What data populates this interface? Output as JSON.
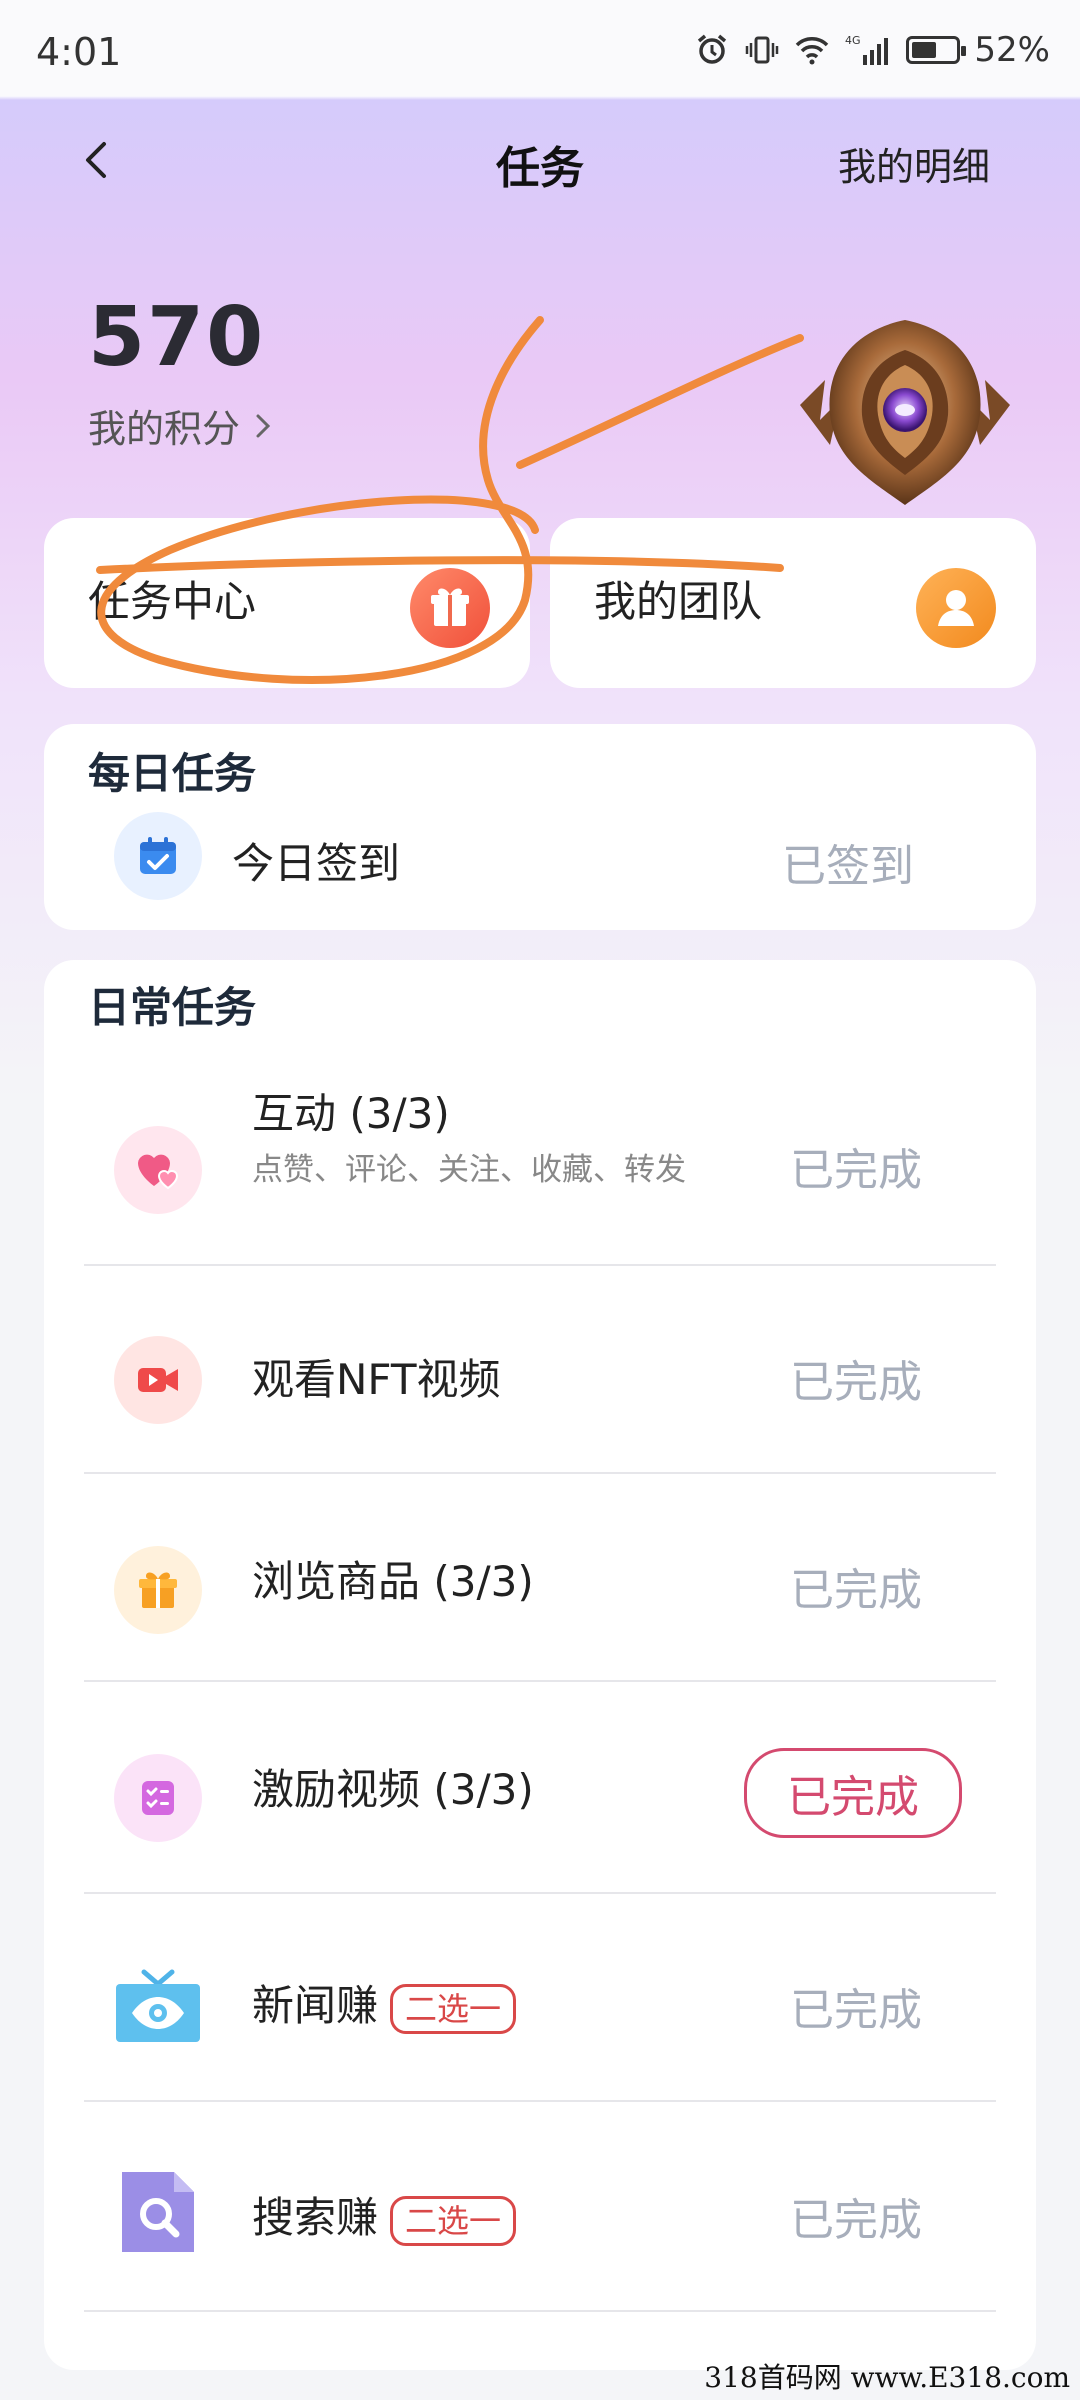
{
  "status_bar": {
    "time": "4:01",
    "network": "4G",
    "battery": "52%"
  },
  "nav": {
    "title": "任务",
    "detail_link": "我的明细"
  },
  "points": {
    "value": "570",
    "label": "我的积分"
  },
  "quick_cards": [
    {
      "label": "任务中心"
    },
    {
      "label": "我的团队"
    }
  ],
  "daily": {
    "title": "每日任务",
    "item": {
      "title": "今日签到",
      "status": "已签到"
    }
  },
  "routine": {
    "title": "日常任务",
    "items": [
      {
        "title": "互动 (3/3)",
        "subtitle": "点赞、评论、关注、收藏、转发",
        "status": "已完成",
        "icon": "heart-icon"
      },
      {
        "title": "观看NFT视频",
        "status": "已完成",
        "icon": "video-camera-icon"
      },
      {
        "title": "浏览商品 (3/3)",
        "status": "已完成",
        "icon": "gift-icon"
      },
      {
        "title": "激励视频 (3/3)",
        "status": "已完成",
        "icon": "checklist-icon"
      },
      {
        "title": "新闻赚",
        "badge": "二选一",
        "status": "已完成",
        "icon": "tv-eye-icon"
      },
      {
        "title": "搜索赚",
        "badge": "二选一",
        "status": "已完成",
        "icon": "search-file-icon"
      }
    ]
  },
  "watermark": "318首码网 www.E318.com",
  "colors": {
    "accent_red": "#d44a6f",
    "badge_red": "#d94848",
    "status_gray": "#a7aebb",
    "scribble": "#f08a3c"
  }
}
